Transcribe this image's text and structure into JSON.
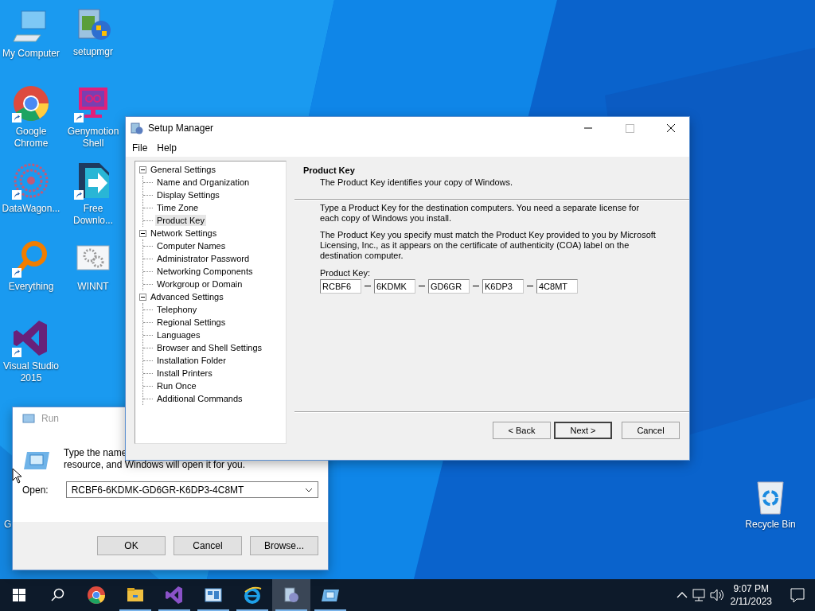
{
  "desktop_icons": [
    {
      "label": "My Computer",
      "shortcut": false
    },
    {
      "label": "setupmgr",
      "shortcut": false
    },
    {
      "label": "Google Chrome",
      "shortcut": true
    },
    {
      "label": "Genymotion Shell",
      "shortcut": true
    },
    {
      "label": "DataWagon...",
      "shortcut": true
    },
    {
      "label": "Free Downlo...",
      "shortcut": true
    },
    {
      "label": "Everything",
      "shortcut": true
    },
    {
      "label": "WINNT",
      "shortcut": false
    },
    {
      "label": "Visual Studio 2015",
      "shortcut": true
    },
    {
      "label": "Recycle Bin",
      "shortcut": false
    },
    {
      "label": "G"
    }
  ],
  "run_dialog": {
    "title": "Run",
    "active": false,
    "text_line_1": "Type the name",
    "text_line_2": "resource, and Windows will open it for you.",
    "open_label": "Open:",
    "value": "RCBF6-6KDMK-GD6GR-K6DP3-4C8MT",
    "buttons": [
      "OK",
      "Cancel",
      "Browse..."
    ]
  },
  "setup_manager": {
    "title": "Setup Manager",
    "menu": [
      "File",
      "Help"
    ],
    "tree": [
      {
        "label": "General Settings",
        "expanded": true,
        "selected": false,
        "children": [
          {
            "label": "Name and Organization",
            "selected": false
          },
          {
            "label": "Display Settings",
            "selected": false
          },
          {
            "label": "Time Zone",
            "selected": false
          },
          {
            "label": "Product Key",
            "selected": true
          }
        ]
      },
      {
        "label": "Network Settings",
        "expanded": true,
        "selected": false,
        "children": [
          {
            "label": "Computer Names",
            "selected": false
          },
          {
            "label": "Administrator Password",
            "selected": false
          },
          {
            "label": "Networking Components",
            "selected": false
          },
          {
            "label": "Workgroup or Domain",
            "selected": false
          }
        ]
      },
      {
        "label": "Advanced Settings",
        "expanded": true,
        "selected": false,
        "children": [
          {
            "label": "Telephony",
            "selected": false
          },
          {
            "label": "Regional Settings",
            "selected": false
          },
          {
            "label": "Languages",
            "selected": false
          },
          {
            "label": "Browser and Shell Settings",
            "selected": false
          },
          {
            "label": "Installation Folder",
            "selected": false
          },
          {
            "label": "Install Printers",
            "selected": false
          },
          {
            "label": "Run Once",
            "selected": false
          },
          {
            "label": "Additional Commands",
            "selected": false
          }
        ]
      }
    ],
    "page_title": "Product Key",
    "page_subtitle": "The Product Key identifies your copy of Windows.",
    "paragraphs": [
      "Type a Product Key for the destination computers. You need a separate license for each copy of Windows you install.",
      "The Product Key you specify must match the Product Key provided to you by Microsoft Licensing, Inc., as it appears on the certificate of authenticity (COA) label on the destination computer."
    ],
    "key_label": "Product Key:",
    "key_parts": [
      "RCBF6",
      "6KDMK",
      "GD6GR",
      "K6DP3",
      "4C8MT"
    ],
    "buttons": [
      {
        "label": "< Back",
        "default": false
      },
      {
        "label": "Next >",
        "default": true
      },
      {
        "label": "Cancel",
        "default": false
      }
    ]
  },
  "taskbar": {
    "apps": [
      {
        "active": false,
        "running": false
      },
      {
        "active": false,
        "running": true
      },
      {
        "active": false,
        "running": true
      },
      {
        "active": false,
        "running": true
      },
      {
        "active": false,
        "running": true
      },
      {
        "active": true,
        "running": true
      },
      {
        "active": false,
        "running": true
      }
    ],
    "time": "9:07 PM",
    "date": "2/11/2023"
  }
}
